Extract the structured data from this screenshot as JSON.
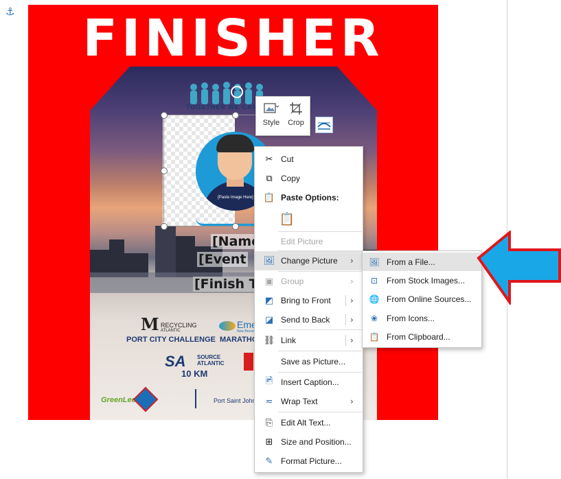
{
  "anchor_icon": "⚓",
  "poster": {
    "title": "FINISHER",
    "together_text": "TOGETHER WE CAN DO",
    "photo_placeholder": "[Paste Image Here]",
    "name_placeholder": "[Name",
    "event_placeholder": "[Event",
    "finish_time_placeholder": "[Finish Ti",
    "sponsors": {
      "recycling_line1": "RECYCLING",
      "recycling_line2": "ATLANTIC",
      "port_city": "PORT CITY CHALLENGE",
      "eme": "Eme",
      "eme_sub": "New Brunsw",
      "maratho": "MARATHO",
      "sa": "SA",
      "source_line1": "SOURCE",
      "source_line2": "ATLANTIC",
      "ten_km": "10 KM",
      "port_saint_john": "Port Saint John",
      "greenlee": "GreenLee"
    },
    "colors": {
      "background": "#ff0000",
      "title": "#ffffff"
    }
  },
  "mini_toolbar": {
    "style_label": "Style",
    "crop_label": "Crop"
  },
  "context_menu": {
    "items": [
      {
        "label": "Cut",
        "icon": "scissors-icon"
      },
      {
        "label": "Copy",
        "icon": "copy-icon"
      },
      {
        "label": "Paste Options:",
        "icon": "clipboard-icon"
      },
      {
        "label": "",
        "icon": "paste-keep-icon"
      },
      {
        "label": "Edit Picture",
        "icon": ""
      },
      {
        "label": "Change Picture",
        "icon": "change-picture-icon",
        "arrow": "›"
      },
      {
        "label": "Group",
        "icon": "group-icon",
        "arrow": "›"
      },
      {
        "label": "Bring to Front",
        "icon": "bring-front-icon",
        "arrow": "›"
      },
      {
        "label": "Send to Back",
        "icon": "send-back-icon",
        "arrow": "›"
      },
      {
        "label": "Link",
        "icon": "link-icon",
        "arrow": "›"
      },
      {
        "label": "Save as Picture...",
        "icon": ""
      },
      {
        "label": "Insert Caption...",
        "icon": "insert-caption-icon"
      },
      {
        "label": "Wrap Text",
        "icon": "wrap-text-icon",
        "arrow": "›"
      },
      {
        "label": "Edit Alt Text...",
        "icon": "alt-text-icon"
      },
      {
        "label": "Size and Position...",
        "icon": "size-position-icon"
      },
      {
        "label": "Format Picture...",
        "icon": "format-picture-icon"
      }
    ]
  },
  "submenu": {
    "items": [
      {
        "label": "From a File...",
        "icon": "from-file-icon"
      },
      {
        "label": "From Stock Images...",
        "icon": "stock-images-icon"
      },
      {
        "label": "From Online Sources...",
        "icon": "online-sources-icon"
      },
      {
        "label": "From Icons...",
        "icon": "icons-icon"
      },
      {
        "label": "From Clipboard...",
        "icon": "clipboard-icon"
      }
    ]
  },
  "annotation": {
    "arrow_color": "#1aa7e8",
    "arrow_outline": "#e0161b"
  }
}
